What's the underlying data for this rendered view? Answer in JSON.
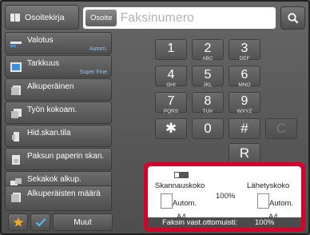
{
  "header": {
    "address_book_label": "Osoitekirja",
    "address_label": "Osoite",
    "address_placeholder": "Faksinumero"
  },
  "menu": {
    "items": [
      {
        "label": "Valotus",
        "value": "Autom."
      },
      {
        "label": "Tarkkuus",
        "value": "Super Fine"
      },
      {
        "label": "Alkuperäinen",
        "value": ""
      },
      {
        "label": "Työn kokoam.",
        "value": ""
      },
      {
        "label": "Hid.skan.tila",
        "value": ""
      },
      {
        "label": "Paksun paperin skan.",
        "value": ""
      },
      {
        "label": "Sekakok alkup.",
        "value": ""
      },
      {
        "label": "Alkuperäisten määrä",
        "value": ""
      }
    ],
    "more_label": "Muut"
  },
  "keypad": {
    "keys": [
      {
        "num": "1",
        "letters": ""
      },
      {
        "num": "2",
        "letters": "ABC"
      },
      {
        "num": "3",
        "letters": "DEF"
      },
      {
        "num": "4",
        "letters": "GHI"
      },
      {
        "num": "5",
        "letters": "JKL"
      },
      {
        "num": "6",
        "letters": "MNO"
      },
      {
        "num": "7",
        "letters": "PQRS"
      },
      {
        "num": "8",
        "letters": "TUV"
      },
      {
        "num": "9",
        "letters": "WXYZ"
      }
    ],
    "asterisk_label": "✱",
    "zero_label": "0",
    "hash_label": "#",
    "clear_label": "C",
    "redial_label": "R"
  },
  "info": {
    "scan_size_label": "Skannauskoko",
    "send_size_label": "Lähetyskoko",
    "ratio": "100%",
    "scan_mode": "Autom.",
    "send_mode": "Autom.",
    "scan_paper": "A4",
    "send_paper": "A4",
    "memory_label": "Faksin vast.ottomuisti:",
    "memory_value": "100%"
  },
  "colors": {
    "highlight": "#d7002a",
    "accent_value": "#8ec3f0",
    "favorite_star": "#f3a421",
    "check": "#58b8f0"
  }
}
